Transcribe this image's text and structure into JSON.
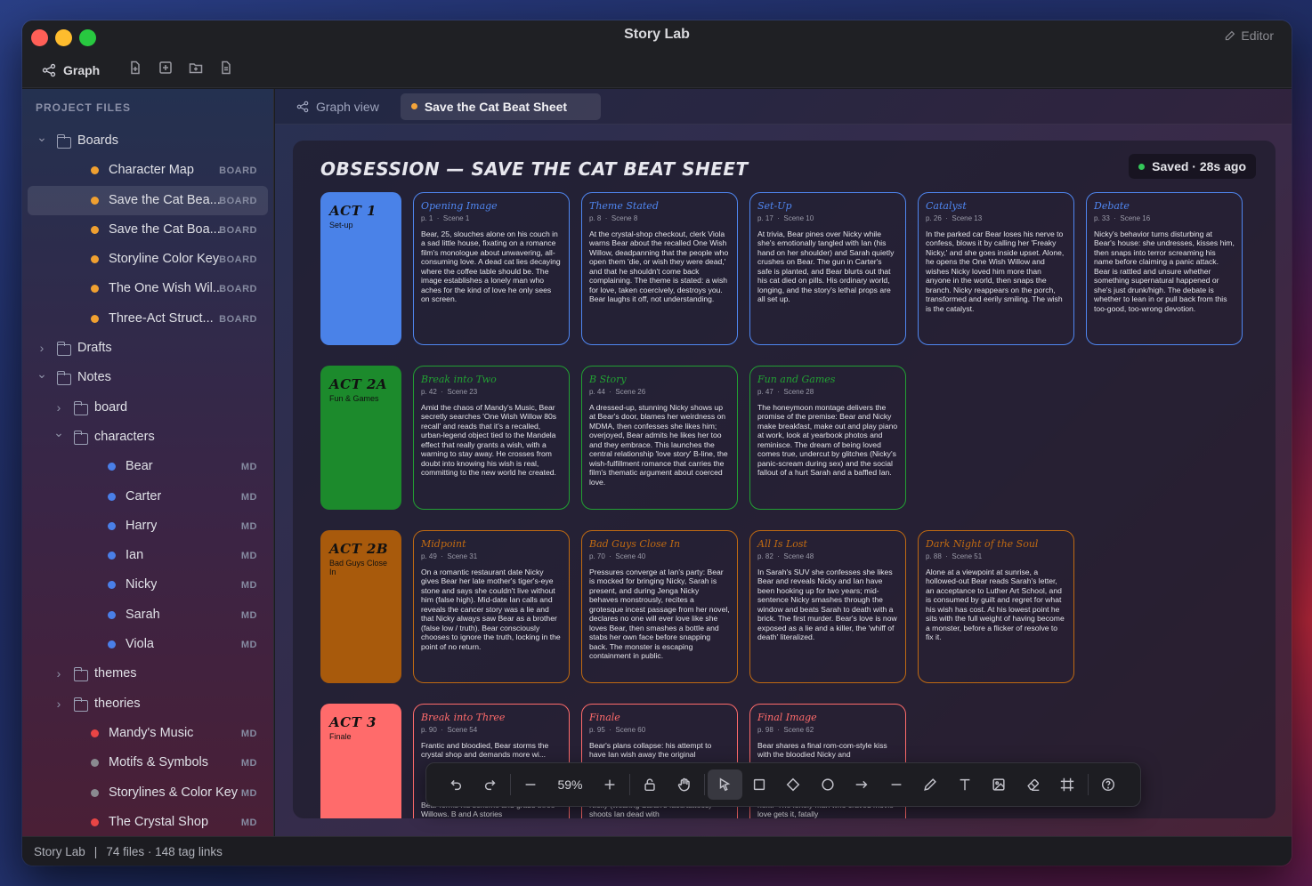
{
  "window": {
    "title": "Story Lab",
    "editor_label": "Editor"
  },
  "toolbar": {
    "graph_label": "Graph"
  },
  "sidebar": {
    "header": "PROJECT FILES",
    "items": [
      {
        "label": "Boards",
        "kind": "folder",
        "indent": 0,
        "expanded": true
      },
      {
        "label": "Character Map",
        "kind": "file",
        "indent": 1,
        "dot": "#f0a030",
        "badge": "BOARD"
      },
      {
        "label": "Save the Cat Bea...",
        "kind": "file",
        "indent": 1,
        "dot": "#f0a030",
        "badge": "BOARD",
        "selected": true
      },
      {
        "label": "Save the Cat Boa...",
        "kind": "file",
        "indent": 1,
        "dot": "#f0a030",
        "badge": "BOARD"
      },
      {
        "label": "Storyline Color Key",
        "kind": "file",
        "indent": 1,
        "dot": "#f0a030",
        "badge": "BOARD"
      },
      {
        "label": "The One Wish Wil...",
        "kind": "file",
        "indent": 1,
        "dot": "#f0a030",
        "badge": "BOARD"
      },
      {
        "label": "Three-Act Struct...",
        "kind": "file",
        "indent": 1,
        "dot": "#f0a030",
        "badge": "BOARD"
      },
      {
        "label": "Drafts",
        "kind": "folder",
        "indent": 0,
        "expanded": false
      },
      {
        "label": "Notes",
        "kind": "folder",
        "indent": 0,
        "expanded": true
      },
      {
        "label": "board",
        "kind": "folder",
        "indent": 1,
        "expanded": false
      },
      {
        "label": "characters",
        "kind": "folder",
        "indent": 1,
        "expanded": true
      },
      {
        "label": "Bear",
        "kind": "file",
        "indent": 2,
        "dot": "#4a7fe8",
        "badge": "MD"
      },
      {
        "label": "Carter",
        "kind": "file",
        "indent": 2,
        "dot": "#4a7fe8",
        "badge": "MD"
      },
      {
        "label": "Harry",
        "kind": "file",
        "indent": 2,
        "dot": "#4a7fe8",
        "badge": "MD"
      },
      {
        "label": "Ian",
        "kind": "file",
        "indent": 2,
        "dot": "#4a7fe8",
        "badge": "MD"
      },
      {
        "label": "Nicky",
        "kind": "file",
        "indent": 2,
        "dot": "#4a7fe8",
        "badge": "MD"
      },
      {
        "label": "Sarah",
        "kind": "file",
        "indent": 2,
        "dot": "#4a7fe8",
        "badge": "MD"
      },
      {
        "label": "Viola",
        "kind": "file",
        "indent": 2,
        "dot": "#4a7fe8",
        "badge": "MD"
      },
      {
        "label": "themes",
        "kind": "folder",
        "indent": 1,
        "expanded": false
      },
      {
        "label": "theories",
        "kind": "folder",
        "indent": 1,
        "expanded": false
      },
      {
        "label": "Mandy's Music",
        "kind": "file",
        "indent": 1,
        "dot": "#e84545",
        "badge": "MD"
      },
      {
        "label": "Motifs & Symbols",
        "kind": "file",
        "indent": 1,
        "dot": "#8a8a90",
        "badge": "MD"
      },
      {
        "label": "Storylines & Color Key",
        "kind": "file",
        "indent": 1,
        "dot": "#8a8a90",
        "badge": "MD"
      },
      {
        "label": "The Crystal Shop",
        "kind": "file",
        "indent": 1,
        "dot": "#e84545",
        "badge": "MD"
      }
    ]
  },
  "tabs": [
    {
      "label": "Graph view",
      "active": false
    },
    {
      "label": "Save the Cat Beat Sheet",
      "active": true
    }
  ],
  "board": {
    "title": "OBSESSION — SAVE THE CAT BEAT SHEET",
    "saved_status": "Saved · 28s ago",
    "acts": [
      {
        "title": "ACT 1",
        "subtitle": "Set-up",
        "color": "#4a82e8"
      },
      {
        "title": "ACT 2A",
        "subtitle": "Fun & Games",
        "color": "#1c8a2c"
      },
      {
        "title": "ACT 2B",
        "subtitle": "Bad Guys Close In",
        "color": "#a85a0c"
      },
      {
        "title": "ACT 3",
        "subtitle": "Finale",
        "color": "#ff6b6b"
      }
    ],
    "rows": [
      {
        "accent": "#4f86f0",
        "beats": [
          {
            "title": "Opening Image",
            "page": "p. 1",
            "scene": "Scene 1",
            "text": "Bear, 25, slouches alone on his couch in a sad little house, fixating on a romance film's monologue about unwavering, all-consuming love. A dead cat lies decaying where the coffee table should be. The image establishes a lonely man who aches for the kind of love he only sees on screen."
          },
          {
            "title": "Theme Stated",
            "page": "p. 8",
            "scene": "Scene 8",
            "text": "At the crystal-shop checkout, clerk Viola warns Bear about the recalled One Wish Willow, deadpanning that the people who open them 'die, or wish they were dead,' and that he shouldn't come back complaining. The theme is stated: a wish for love, taken coercively, destroys you. Bear laughs it off, not understanding."
          },
          {
            "title": "Set-Up",
            "page": "p. 17",
            "scene": "Scene 10",
            "text": "At trivia, Bear pines over Nicky while she's emotionally tangled with Ian (his hand on her shoulder) and Sarah quietly crushes on Bear. The gun in Carter's safe is planted, and Bear blurts out that his cat died on pills. His ordinary world, longing, and the story's lethal props are all set up."
          },
          {
            "title": "Catalyst",
            "page": "p. 26",
            "scene": "Scene 13",
            "text": "In the parked car Bear loses his nerve to confess, blows it by calling her 'Freaky Nicky,' and she goes inside upset. Alone, he opens the One Wish Willow and wishes Nicky loved him more than anyone in the world, then snaps the branch. Nicky reappears on the porch, transformed and eerily smiling. The wish is the catalyst."
          },
          {
            "title": "Debate",
            "page": "p. 33",
            "scene": "Scene 16",
            "text": "Nicky's behavior turns disturbing at Bear's house: she undresses, kisses him, then snaps into terror screaming his name before claiming a panic attack. Bear is rattled and unsure whether something supernatural happened or she's just drunk/high. The debate is whether to lean in or pull back from this too-good, too-wrong devotion."
          }
        ]
      },
      {
        "accent": "#22a033",
        "beats": [
          {
            "title": "Break into Two",
            "page": "p. 42",
            "scene": "Scene 23",
            "text": "Amid the chaos of Mandy's Music, Bear secretly searches 'One Wish Willow 80s recall' and reads that it's a recalled, urban-legend object tied to the Mandela effect that really grants a wish, with a warning to stay away. He crosses from doubt into knowing his wish is real, committing to the new world he created."
          },
          {
            "title": "B Story",
            "page": "p. 44",
            "scene": "Scene 26",
            "text": "A dressed-up, stunning Nicky shows up at Bear's door, blames her weirdness on MDMA, then confesses she likes him; overjoyed, Bear admits he likes her too and they embrace. This launches the central relationship 'love story' B-line, the wish-fulfillment romance that carries the film's thematic argument about coerced love."
          },
          {
            "title": "Fun and Games",
            "page": "p. 47",
            "scene": "Scene 28",
            "text": "The honeymoon montage delivers the promise of the premise: Bear and Nicky make breakfast, make out and play piano at work, look at yearbook photos and reminisce. The dream of being loved comes true, undercut by glitches (Nicky's panic-scream during sex) and the social fallout of a hurt Sarah and a baffled Ian."
          }
        ]
      },
      {
        "accent": "#c06a12",
        "beats": [
          {
            "title": "Midpoint",
            "page": "p. 49",
            "scene": "Scene 31",
            "text": "On a romantic restaurant date Nicky gives Bear her late mother's tiger's-eye stone and says she couldn't live without him (false high). Mid-date Ian calls and reveals the cancer story was a lie and that Nicky always saw Bear as a brother (false low / truth). Bear consciously chooses to ignore the truth, locking in the point of no return."
          },
          {
            "title": "Bad Guys Close In",
            "page": "p. 70",
            "scene": "Scene 40",
            "text": "Pressures converge at Ian's party: Bear is mocked for bringing Nicky, Sarah is present, and during Jenga Nicky behaves monstrously, recites a grotesque incest passage from her novel, declares no one will ever love like she loves Bear, then smashes a bottle and stabs her own face before snapping back. The monster is escaping containment in public."
          },
          {
            "title": "All Is Lost",
            "page": "p. 82",
            "scene": "Scene 48",
            "text": "In Sarah's SUV she confesses she likes Bear and reveals Nicky and Ian have been hooking up for two years; mid-sentence Nicky smashes through the window and beats Sarah to death with a brick. The first murder. Bear's love is now exposed as a lie and a killer, the 'whiff of death' literalized."
          },
          {
            "title": "Dark Night of the Soul",
            "page": "p. 88",
            "scene": "Scene 51",
            "text": "Alone at a viewpoint at sunrise, a hollowed-out Bear reads Sarah's letter, an acceptance to Luther Art School, and is consumed by guilt and regret for what his wish has cost. At his lowest point he sits with the full weight of having become a monster, before a flicker of resolve to fix it."
          }
        ]
      },
      {
        "accent": "#ff6b6b",
        "beats": [
          {
            "title": "Break into Three",
            "page": "p. 90",
            "scene": "Scene 54",
            "text": "Frantic and bloodied, Bear storms the crystal shop and demands more wi...",
            "tail": "Bear forms his scheme and grabs three Willows. B and A stories"
          },
          {
            "title": "Finale",
            "page": "p. 95",
            "scene": "Scene 60",
            "text": "Bear's plans collapse: his attempt to have Ian wish away the original",
            "tail": "Nicky (wearing Sarah's face/tattoos) shoots Ian dead with"
          },
          {
            "title": "Final Image",
            "page": "p. 98",
            "scene": "Scene 62",
            "text": "Bear shares a final rom-com-style kiss with the bloodied Nicky and",
            "tail": "next.' The lonely man who craved movie love gets it, fatally"
          }
        ]
      }
    ]
  },
  "bottom_toolbar": {
    "zoom": "59%",
    "tools": [
      "undo-icon",
      "redo-icon",
      "sep",
      "zoom-out-icon",
      "zoom-label",
      "zoom-in-icon",
      "sep",
      "lock-icon",
      "hand-icon",
      "sep",
      "pointer-icon",
      "rectangle-icon",
      "diamond-icon",
      "ellipse-icon",
      "arrow-icon",
      "line-icon",
      "pencil-icon",
      "text-icon",
      "image-icon",
      "eraser-icon",
      "frame-icon",
      "sep",
      "help-icon"
    ],
    "active_tool": "pointer-icon"
  },
  "status": {
    "app": "Story Lab",
    "sep": "|",
    "summary": "74 files · 148 tag links"
  }
}
